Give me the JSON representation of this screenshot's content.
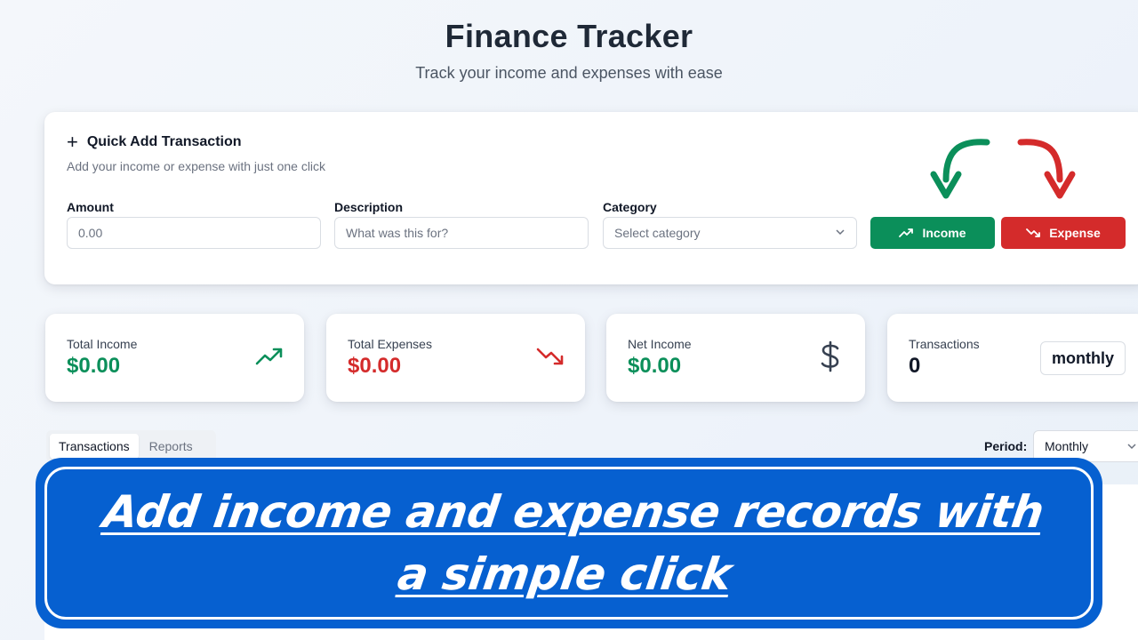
{
  "header": {
    "title": "Finance Tracker",
    "subtitle": "Track your income and expenses with ease"
  },
  "quick_add": {
    "title": "Quick Add Transaction",
    "subtitle": "Add your income or expense with just one click",
    "amount": {
      "label": "Amount",
      "placeholder": "0.00",
      "value": ""
    },
    "description": {
      "label": "Description",
      "placeholder": "What was this for?",
      "value": ""
    },
    "category": {
      "label": "Category",
      "placeholder": "Select category"
    },
    "income_button": "Income",
    "expense_button": "Expense"
  },
  "stats": {
    "total_income": {
      "label": "Total Income",
      "value": "$0.00"
    },
    "total_expenses": {
      "label": "Total Expenses",
      "value": "$0.00"
    },
    "net_income": {
      "label": "Net Income",
      "value": "$0.00"
    },
    "transactions": {
      "label": "Transactions",
      "value": "0",
      "period_badge": "monthly"
    }
  },
  "tabs": [
    {
      "label": "Transactions",
      "active": true
    },
    {
      "label": "Reports",
      "active": false
    }
  ],
  "period": {
    "label": "Period:",
    "selected": "Monthly"
  },
  "banner": {
    "text": "Add income and expense records with a simple click"
  },
  "colors": {
    "income_green": "#0b8f5a",
    "expense_red": "#d42b2b",
    "banner_blue": "#0660d0"
  },
  "icons": [
    "plus-icon",
    "trending-up-icon",
    "trending-down-icon",
    "dollar-icon",
    "chevron-down-icon"
  ]
}
